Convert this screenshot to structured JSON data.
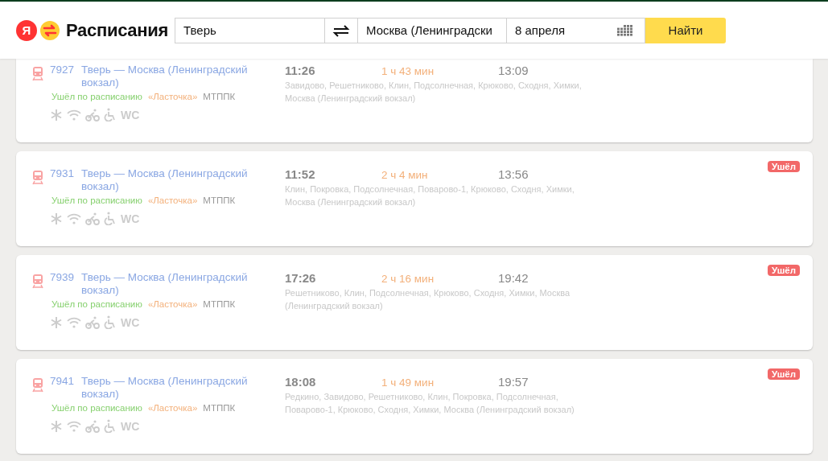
{
  "header": {
    "logo_letter": "Я",
    "brand": "Расписания",
    "from": "Тверь",
    "to": "Москва (Ленинградски",
    "date": "8 апреля",
    "search_button": "Найти"
  },
  "trips": [
    {
      "number": "7927",
      "route": "Тверь — Москва (Ленинградский вокзал)",
      "status": "Ушёл по расписанию",
      "train_type": "«Ласточка»",
      "carrier": "МТППК",
      "departure": "11:26",
      "duration": "1 ч 43 мин",
      "arrival": "13:09",
      "stops": "Завидово, Решетниково, Клин, Подсолнечная, Крюково, Сходня, Химки, Москва (Ленинградский вокзал)",
      "wc": "WC"
    },
    {
      "number": "7931",
      "route": "Тверь — Москва (Ленинградский вокзал)",
      "status": "Ушёл по расписанию",
      "train_type": "«Ласточка»",
      "carrier": "МТППК",
      "departure": "11:52",
      "duration": "2 ч 4 мин",
      "arrival": "13:56",
      "stops": "Клин, Покровка, Подсолнечная, Поварово-1, Крюково, Сходня, Химки, Москва (Ленинградский вокзал)",
      "badge": "Ушёл",
      "wc": "WC"
    },
    {
      "number": "7939",
      "route": "Тверь — Москва (Ленинградский вокзал)",
      "status": "Ушёл по расписанию",
      "train_type": "«Ласточка»",
      "carrier": "МТППК",
      "departure": "17:26",
      "duration": "2 ч 16 мин",
      "arrival": "19:42",
      "stops": "Решетниково, Клин, Подсолнечная, Крюково, Сходня, Химки, Москва (Ленинградский вокзал)",
      "badge": "Ушёл",
      "wc": "WC"
    },
    {
      "number": "7941",
      "route": "Тверь — Москва (Ленинградский вокзал)",
      "status": "Ушёл по расписанию",
      "train_type": "«Ласточка»",
      "carrier": "МТППК",
      "departure": "18:08",
      "duration": "1 ч 49 мин",
      "arrival": "19:57",
      "stops": "Редкино, Завидово, Решетниково, Клин, Покровка, Подсолнечная, Поварово-1, Крюково, Сходня, Химки, Москва (Ленинградский вокзал)",
      "badge": "Ушёл",
      "wc": "WC"
    }
  ]
}
